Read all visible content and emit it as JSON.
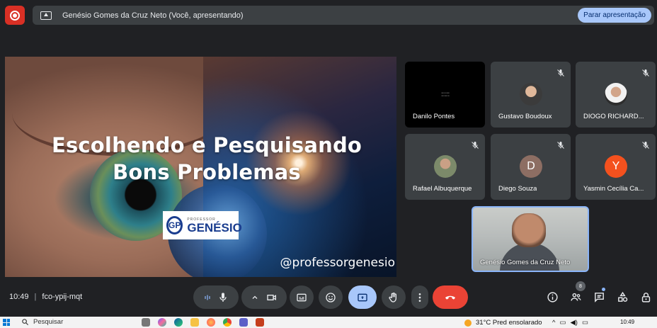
{
  "presenting_bar": {
    "text": "Genésio Gomes da Cruz Neto (Você, apresentando)",
    "stop_label": "Parar apresentação"
  },
  "slide": {
    "title_line1": "Escolhendo e Pesquisando",
    "title_line2": "Bons Problemas",
    "logo_small": "PROFESSOR",
    "logo_big": "GENÉSIO",
    "logo_mark": "GP",
    "handle": "@professorgenesio"
  },
  "participants": [
    {
      "name": "Danilo Pontes",
      "kind": "screen",
      "muted": false
    },
    {
      "name": "Gustavo Boudoux",
      "kind": "photo",
      "muted": true
    },
    {
      "name": "DIOGO RICHARD...",
      "kind": "photo",
      "muted": true
    },
    {
      "name": "Rafael Albuquerque",
      "kind": "photo",
      "muted": true
    },
    {
      "name": "Diego Souza",
      "kind": "initial",
      "initial": "D",
      "color": "#8d6e63",
      "muted": true
    },
    {
      "name": "Yasmin Cecília Ca...",
      "kind": "initial",
      "initial": "Y",
      "color": "#f4511e",
      "muted": true
    }
  ],
  "self_view": {
    "name": "Genésio Gomes da Cruz Neto"
  },
  "meeting": {
    "time": "10:49",
    "code": "fco-ypij-mqt"
  },
  "people_count": "8",
  "colors": {
    "end_call": "#ea4335",
    "active": "#a8c7fa",
    "record": "#d93025"
  },
  "taskbar": {
    "search": "Pesquisar",
    "weather": "31°C  Pred ensolarado",
    "clock": "10:49",
    "notification_count": "1"
  }
}
